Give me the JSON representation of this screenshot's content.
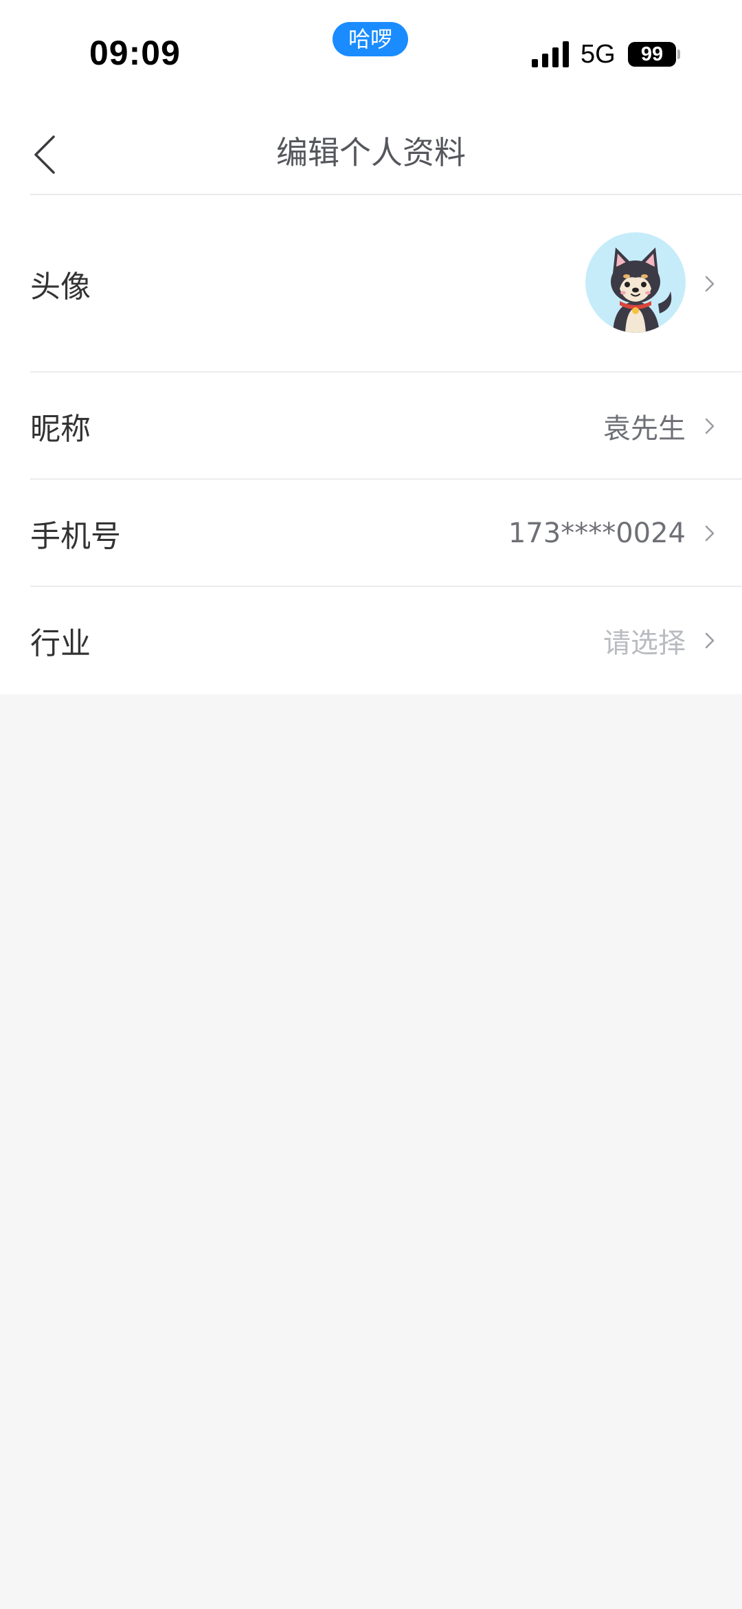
{
  "status_bar": {
    "time": "09:09",
    "pill_label": "哈啰",
    "network": "5G",
    "battery": "99"
  },
  "nav": {
    "title": "编辑个人资料",
    "back_icon": "chevron-left-icon"
  },
  "rows": {
    "avatar": {
      "label": "头像",
      "icon": "dog-avatar"
    },
    "nickname": {
      "label": "昵称",
      "value": "袁先生"
    },
    "phone": {
      "label": "手机号",
      "value": "173****0024"
    },
    "industry": {
      "label": "行业",
      "placeholder": "请选择"
    }
  },
  "colors": {
    "accent": "#1a8cff",
    "background": "#f6f6f7",
    "avatar_bg": "#c6ecfa",
    "placeholder": "#b9bbc0"
  }
}
